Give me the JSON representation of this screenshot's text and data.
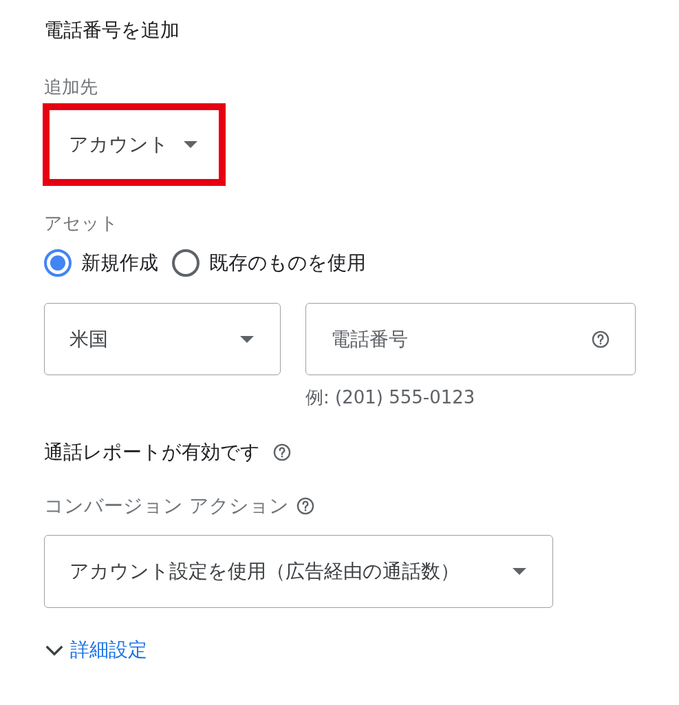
{
  "title": "電話番号を追加",
  "destination": {
    "label": "追加先",
    "value": "アカウント",
    "highlighted": true
  },
  "asset": {
    "label": "アセット",
    "options": [
      {
        "label": "新規作成",
        "selected": true
      },
      {
        "label": "既存のものを使用",
        "selected": false
      }
    ]
  },
  "country": {
    "value": "米国"
  },
  "phone": {
    "placeholder": "電話番号",
    "hint": "例: (201) 555-0123"
  },
  "call_reporting": {
    "text": "通話レポートが有効です"
  },
  "conversion": {
    "label": "コンバージョン アクション",
    "value": "アカウント設定を使用（広告経由の通話数）"
  },
  "advanced": {
    "label": "詳細設定",
    "expanded": false
  }
}
